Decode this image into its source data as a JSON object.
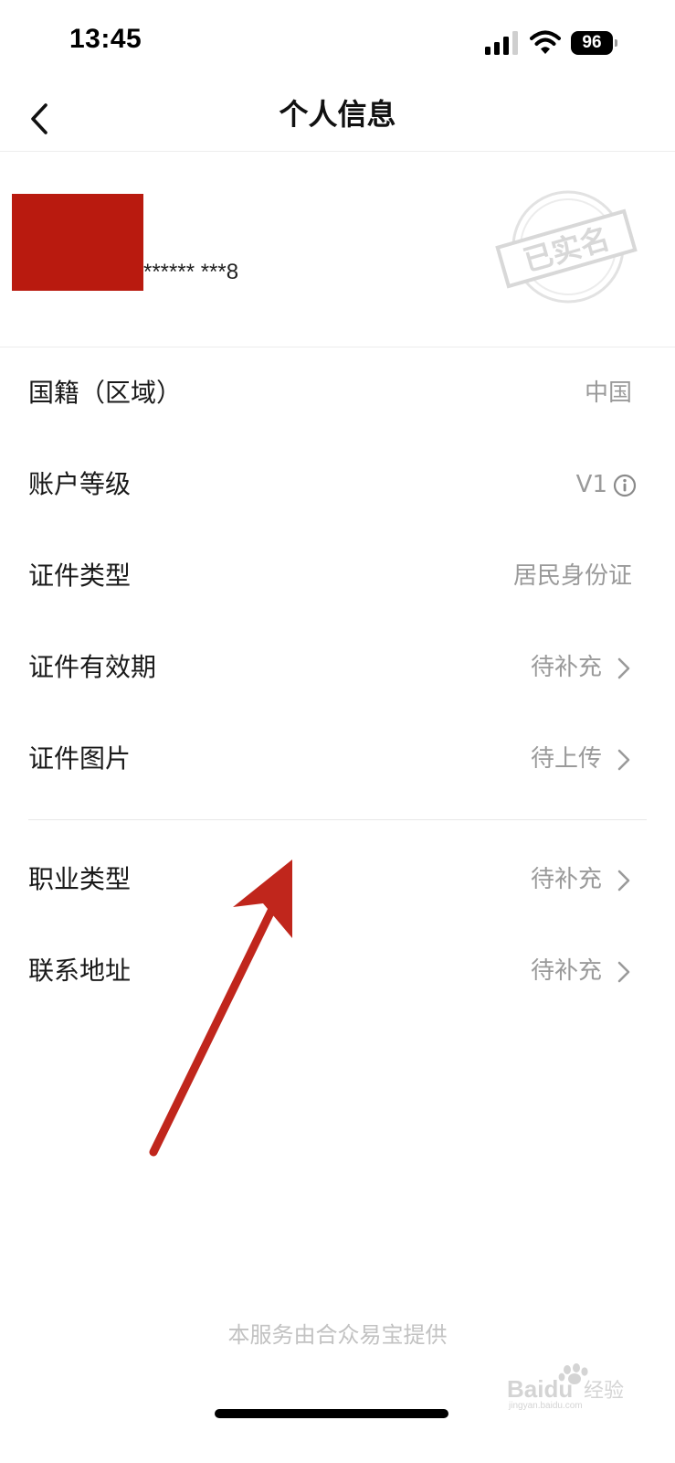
{
  "status_bar": {
    "time": "13:45",
    "battery": "96",
    "signal_icon": "cellular-signal-icon",
    "wifi_icon": "wifi-icon"
  },
  "nav": {
    "back_icon": "chevron-left-icon",
    "title": "个人信息"
  },
  "profile": {
    "masked_id": "****** ***8",
    "stamp_text": "已实名",
    "avatar_color": "#b91a0f"
  },
  "rows": [
    {
      "label": "国籍（区域）",
      "value": "中国"
    },
    {
      "label": "账户等级",
      "value": "V1"
    },
    {
      "label": "证件类型",
      "value": "居民身份证"
    },
    {
      "label": "证件有效期",
      "value": "待补充"
    },
    {
      "label": "证件图片",
      "value": "待上传"
    },
    {
      "label": "职业类型",
      "value": "待补充"
    },
    {
      "label": "联系地址",
      "value": "待补充"
    }
  ],
  "footer": {
    "text": "本服务由合众易宝提供"
  },
  "watermark": {
    "brand": "Baidu",
    "suffix": "经验",
    "url": "jingyan.baidu.com"
  },
  "colors": {
    "annotation_arrow": "#c0261c",
    "muted_text": "#9a9a9a"
  }
}
